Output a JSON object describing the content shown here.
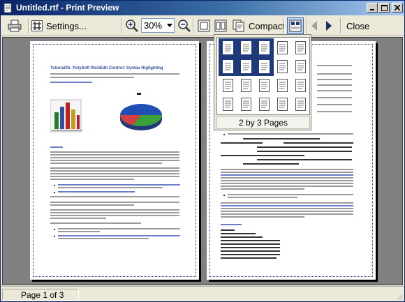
{
  "window": {
    "title": "Untitled.rtf - Print Preview",
    "accent": "#0a246a"
  },
  "toolbar": {
    "print_icon": "printer-icon",
    "settings_label": "Settings...",
    "zoom_in_icon": "zoom-in-icon",
    "zoom_value": "30%",
    "zoom_out_icon": "zoom-out-icon",
    "compact_label": "Compact",
    "close_label": "Close"
  },
  "page_picker": {
    "label": "2 by 3 Pages",
    "selected_color": "#1e3a7a"
  },
  "document": {
    "page1_title": "Tutorial35: PolySoft RichEdit Control: Syntax Higlighting"
  },
  "statusbar": {
    "page_text": "Page 1 of 3"
  }
}
